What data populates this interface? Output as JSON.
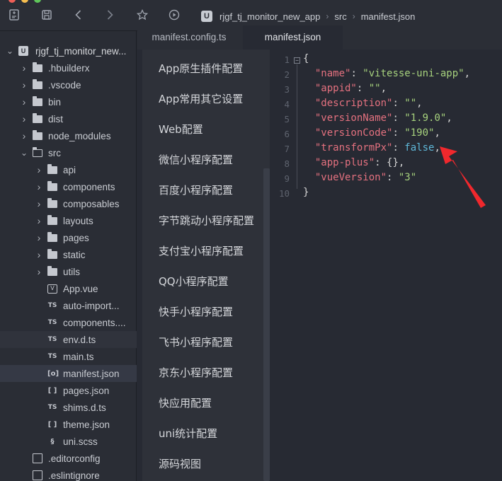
{
  "breadcrumb": [
    "rjgf_tj_monitor_new_app",
    "src",
    "manifest.json"
  ],
  "breadcrumb_logo": "U",
  "toolbar_icons": [
    "new-file-icon",
    "save-icon",
    "back-icon",
    "forward-icon",
    "star-icon",
    "run-icon"
  ],
  "tabs": [
    {
      "label": "manifest.config.ts",
      "active": false
    },
    {
      "label": "manifest.json",
      "active": true
    }
  ],
  "tree": [
    {
      "label": "rjgf_tj_monitor_new...",
      "type": "project",
      "depth": 0,
      "expanded": true
    },
    {
      "label": ".hbuilderx",
      "type": "folder",
      "depth": 1
    },
    {
      "label": ".vscode",
      "type": "folder",
      "depth": 1
    },
    {
      "label": "bin",
      "type": "folder",
      "depth": 1
    },
    {
      "label": "dist",
      "type": "folder",
      "depth": 1
    },
    {
      "label": "node_modules",
      "type": "folder",
      "depth": 1
    },
    {
      "label": "src",
      "type": "folder",
      "depth": 1,
      "expanded": true
    },
    {
      "label": "api",
      "type": "folder",
      "depth": 2
    },
    {
      "label": "components",
      "type": "folder",
      "depth": 2
    },
    {
      "label": "composables",
      "type": "folder",
      "depth": 2
    },
    {
      "label": "layouts",
      "type": "folder",
      "depth": 2
    },
    {
      "label": "pages",
      "type": "folder",
      "depth": 2
    },
    {
      "label": "static",
      "type": "folder",
      "depth": 2
    },
    {
      "label": "utils",
      "type": "folder",
      "depth": 2
    },
    {
      "label": "App.vue",
      "type": "file",
      "icon": "V",
      "depth": 2
    },
    {
      "label": "auto-import...",
      "type": "file",
      "icon": "TS",
      "depth": 2
    },
    {
      "label": "components....",
      "type": "file",
      "icon": "TS",
      "depth": 2
    },
    {
      "label": "env.d.ts",
      "type": "file",
      "icon": "TS",
      "depth": 2,
      "hover": true
    },
    {
      "label": "main.ts",
      "type": "file",
      "icon": "TS",
      "depth": 2
    },
    {
      "label": "manifest.json",
      "type": "file",
      "icon": "[o]",
      "depth": 2,
      "selected": true
    },
    {
      "label": "pages.json",
      "type": "file",
      "icon": "[ ]",
      "depth": 2
    },
    {
      "label": "shims.d.ts",
      "type": "file",
      "icon": "TS",
      "depth": 2
    },
    {
      "label": "theme.json",
      "type": "file",
      "icon": "[ ]",
      "depth": 2
    },
    {
      "label": "uni.scss",
      "type": "file",
      "icon": "§",
      "depth": 2
    },
    {
      "label": ".editorconfig",
      "type": "file",
      "icon": "page",
      "depth": 1
    },
    {
      "label": ".eslintignore",
      "type": "file",
      "icon": "page",
      "depth": 1
    }
  ],
  "config_menu": [
    "App原生插件配置",
    "App常用其它设置",
    "Web配置",
    "微信小程序配置",
    "百度小程序配置",
    "字节跳动小程序配置",
    "支付宝小程序配置",
    "QQ小程序配置",
    "快手小程序配置",
    "飞书小程序配置",
    "京东小程序配置",
    "快应用配置",
    "uni统计配置",
    "源码视图"
  ],
  "code_lines": [
    [
      {
        "t": "{",
        "c": "p"
      }
    ],
    [
      {
        "t": "  \"name\"",
        "c": "k"
      },
      {
        "t": ": ",
        "c": "p"
      },
      {
        "t": "\"vitesse-uni-app\"",
        "c": "s"
      },
      {
        "t": ",",
        "c": "p"
      }
    ],
    [
      {
        "t": "  \"appid\"",
        "c": "k"
      },
      {
        "t": ": ",
        "c": "p"
      },
      {
        "t": "\"\"",
        "c": "s"
      },
      {
        "t": ",",
        "c": "p"
      }
    ],
    [
      {
        "t": "  \"description\"",
        "c": "k"
      },
      {
        "t": ": ",
        "c": "p"
      },
      {
        "t": "\"\"",
        "c": "s"
      },
      {
        "t": ",",
        "c": "p"
      }
    ],
    [
      {
        "t": "  \"versionName\"",
        "c": "k"
      },
      {
        "t": ": ",
        "c": "p"
      },
      {
        "t": "\"1.9.0\"",
        "c": "s"
      },
      {
        "t": ",",
        "c": "p"
      }
    ],
    [
      {
        "t": "  \"versionCode\"",
        "c": "k"
      },
      {
        "t": ": ",
        "c": "p"
      },
      {
        "t": "\"190\"",
        "c": "s"
      },
      {
        "t": ",",
        "c": "p"
      }
    ],
    [
      {
        "t": "  \"transformPx\"",
        "c": "k"
      },
      {
        "t": ": ",
        "c": "p"
      },
      {
        "t": "false",
        "c": "b"
      },
      {
        "t": ",",
        "c": "p"
      }
    ],
    [
      {
        "t": "  \"app-plus\"",
        "c": "k"
      },
      {
        "t": ": {},",
        "c": "p"
      }
    ],
    [
      {
        "t": "  \"vueVersion\"",
        "c": "k"
      },
      {
        "t": ": ",
        "c": "p"
      },
      {
        "t": "\"3\"",
        "c": "s"
      }
    ],
    [
      {
        "t": "}",
        "c": "p"
      }
    ]
  ],
  "colors": {
    "key": "#e4717f",
    "string": "#a6d17d",
    "boolean": "#5fb8d9",
    "arrow": "#f0282d"
  }
}
